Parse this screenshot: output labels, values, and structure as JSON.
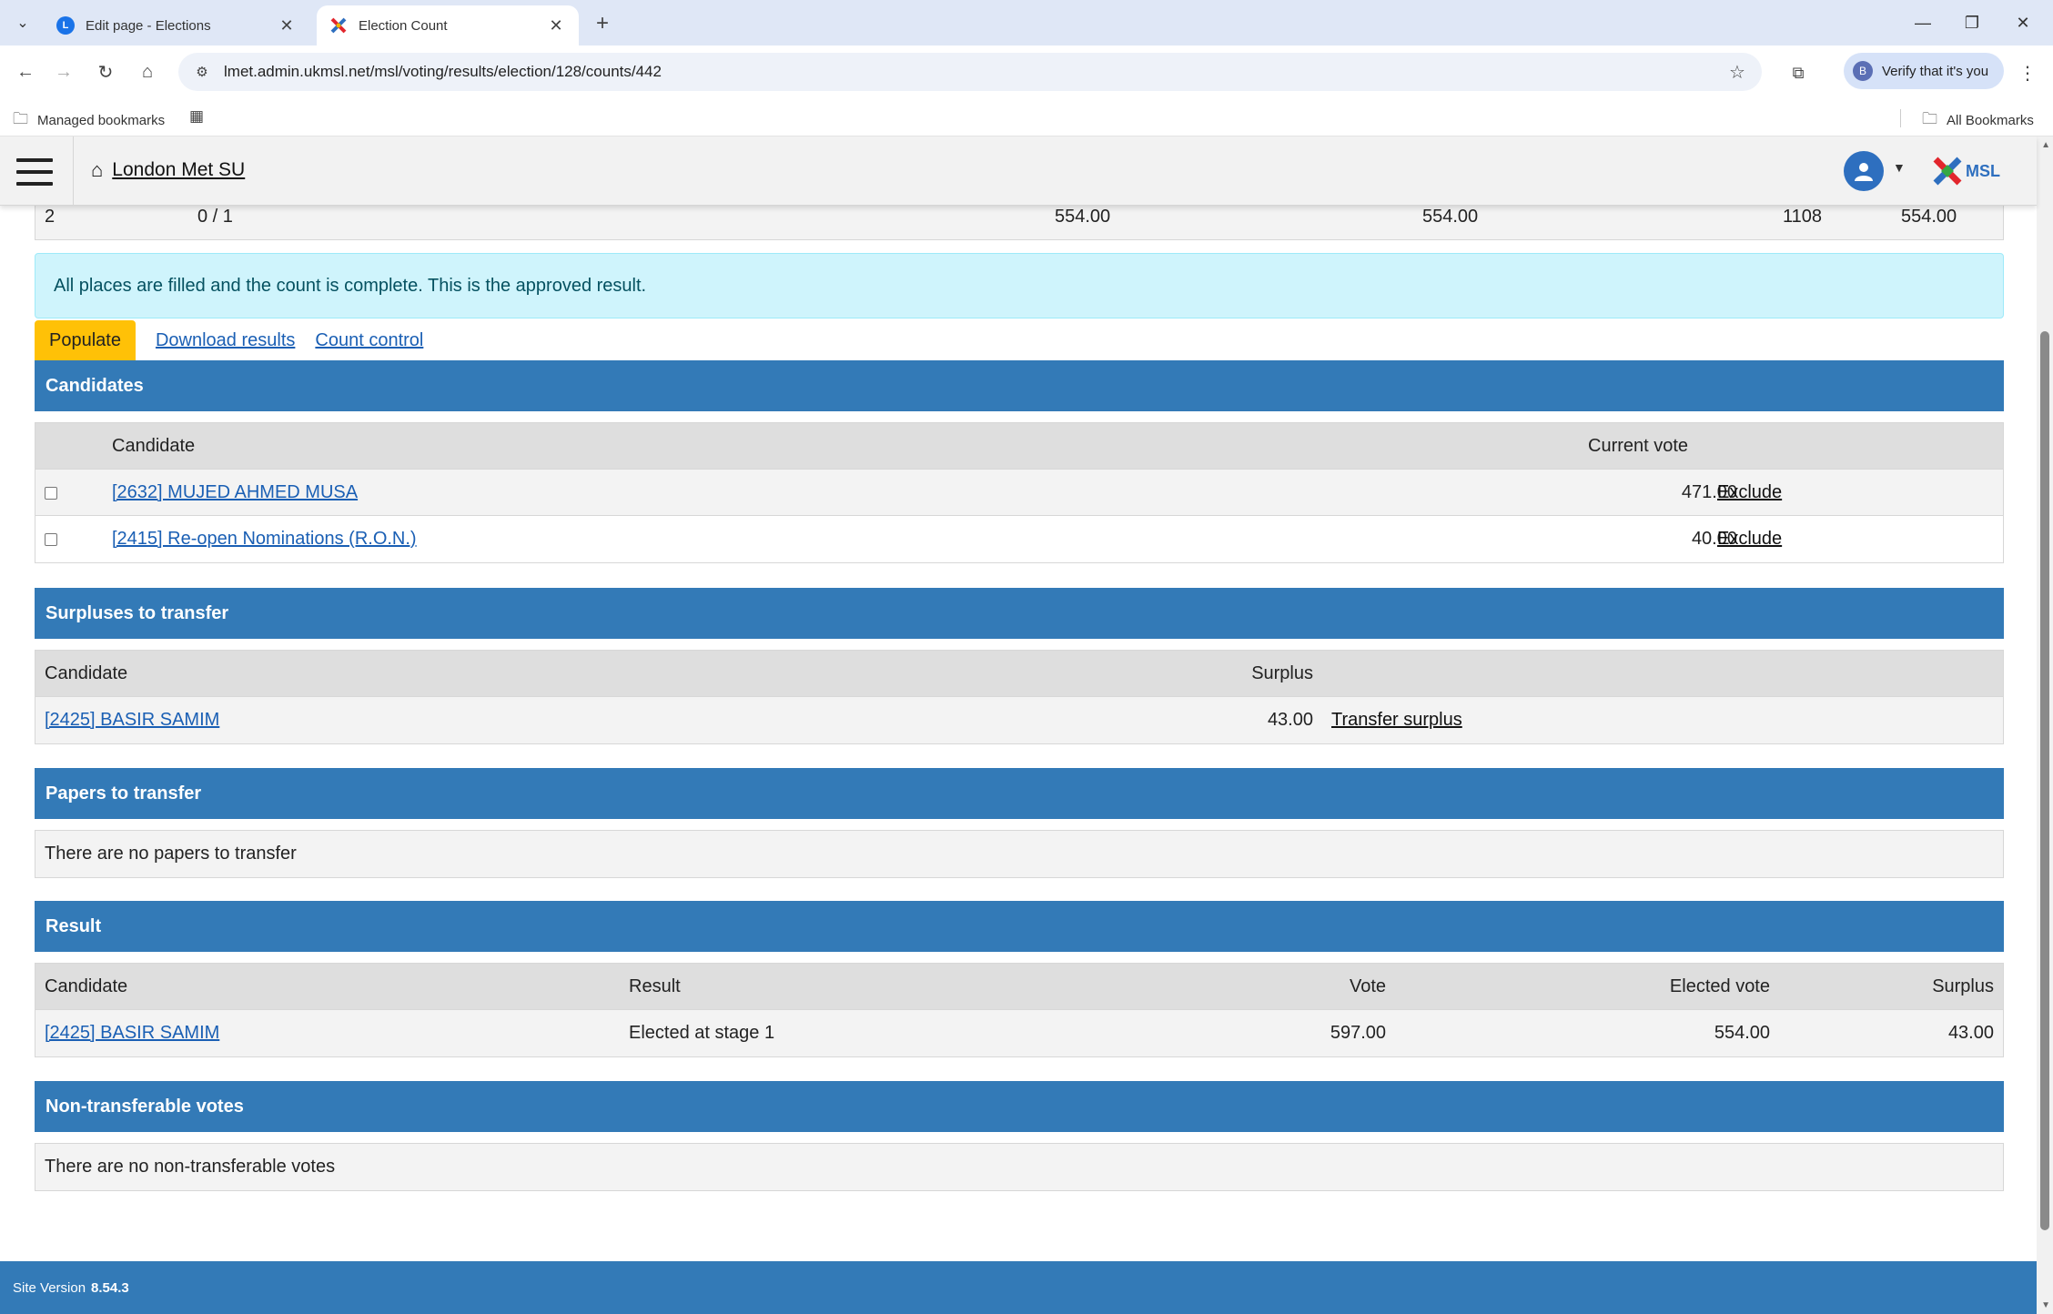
{
  "browser": {
    "tabs": [
      {
        "title": "Edit page - Elections",
        "favicon": "L"
      },
      {
        "title": "Election Count",
        "favicon": "msl"
      }
    ],
    "url": "lmet.admin.ukmsl.net/msl/voting/results/election/128/counts/442",
    "verify_label": "Verify that it's you",
    "bookmarks": {
      "managed": "Managed bookmarks",
      "all": "All Bookmarks"
    }
  },
  "header": {
    "site_name": "London Met SU",
    "logo_text": "MSL"
  },
  "summary_row": {
    "stage": "2",
    "places": "0 / 1",
    "v1": "554.00",
    "v2": "554.00",
    "v3": "1108",
    "v4": "554.00"
  },
  "alert": "All places are filled and the count is complete. This is the approved result.",
  "actions": {
    "populate": "Populate",
    "download": "Download results",
    "count_control": "Count control"
  },
  "candidates": {
    "title": "Candidates",
    "col_candidate": "Candidate",
    "col_vote": "Current vote",
    "rows": [
      {
        "name": "[2632] MUJED AHMED MUSA",
        "vote": "471.00",
        "action": "Exclude"
      },
      {
        "name": "[2415] Re-open Nominations (R.O.N.)",
        "vote": "40.00",
        "action": "Exclude"
      }
    ]
  },
  "surpluses": {
    "title": "Surpluses to transfer",
    "col_candidate": "Candidate",
    "col_surplus": "Surplus",
    "rows": [
      {
        "name": "[2425] BASIR SAMIM",
        "surplus": "43.00",
        "action": "Transfer surplus"
      }
    ]
  },
  "papers": {
    "title": "Papers to transfer",
    "empty": "There are no papers to transfer"
  },
  "result": {
    "title": "Result",
    "cols": {
      "candidate": "Candidate",
      "result": "Result",
      "vote": "Vote",
      "elected": "Elected vote",
      "surplus": "Surplus"
    },
    "rows": [
      {
        "name": "[2425] BASIR SAMIM",
        "result": "Elected at stage 1",
        "vote": "597.00",
        "elected": "554.00",
        "surplus": "43.00"
      }
    ]
  },
  "nontransferable": {
    "title": "Non-transferable votes",
    "empty": "There are no non-transferable votes"
  },
  "footer": {
    "label": "Site Version",
    "version": "8.54.3"
  },
  "colors": {
    "section": "#337ab7",
    "alert_bg": "#cff4fc",
    "populate": "#ffc107",
    "link": "#1a5fb4"
  }
}
